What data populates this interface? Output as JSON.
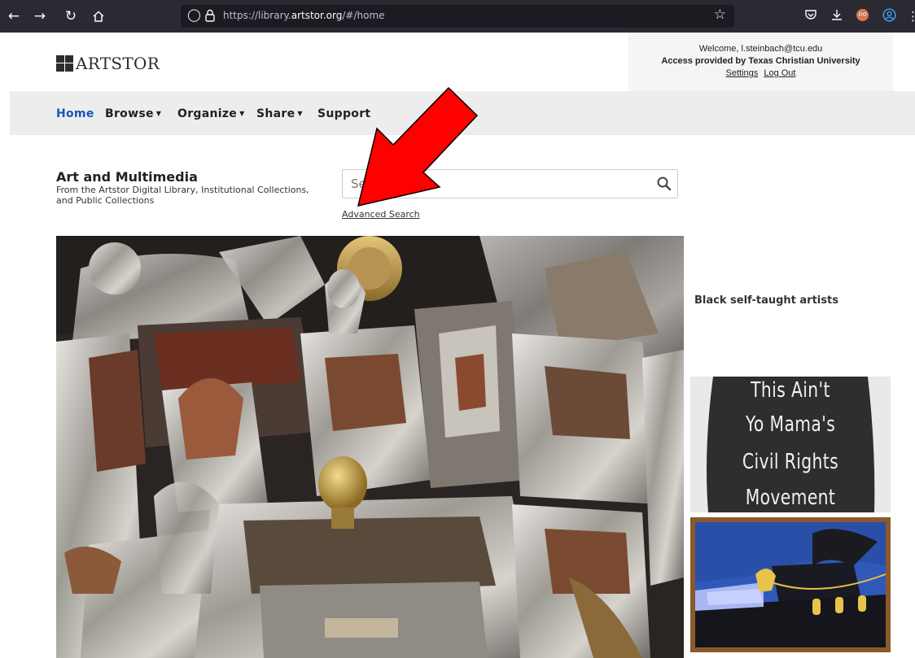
{
  "browser": {
    "url_prefix": "https://library.",
    "url_domain": "artstor.org",
    "url_path": "/#/home",
    "icons": [
      "back-icon",
      "forward-icon",
      "reload-icon",
      "home-icon",
      "shield-icon",
      "lock-icon",
      "star-icon",
      "pocket-icon",
      "download-icon",
      "extension-icon",
      "account-icon"
    ]
  },
  "header": {
    "logo_text": "ARTSTOR",
    "welcome": "Welcome, l.steinbach@tcu.edu",
    "access": "Access provided by Texas Christian University",
    "settings": "Settings",
    "logout": "Log Out"
  },
  "nav": {
    "home": "Home",
    "browse": "Browse",
    "organize": "Organize",
    "share": "Share",
    "support": "Support"
  },
  "main": {
    "title": "Art and Multimedia",
    "subtitle": "From the Artstor Digital Library, Institutional Collections, and Public Collections",
    "search_placeholder": "Search",
    "advanced_search": "Advanced Search",
    "feature_label": "Black self-taught artists"
  },
  "thumbnails": {
    "shirt_lines": [
      "This Ain't",
      "Yo Mama's",
      "Civil Rights",
      "Movement"
    ]
  },
  "colors": {
    "browser_chrome": "#2b2a33",
    "nav_active": "#1a55b8",
    "nav_bg": "#ededed",
    "annotation_arrow": "#ff0000"
  }
}
